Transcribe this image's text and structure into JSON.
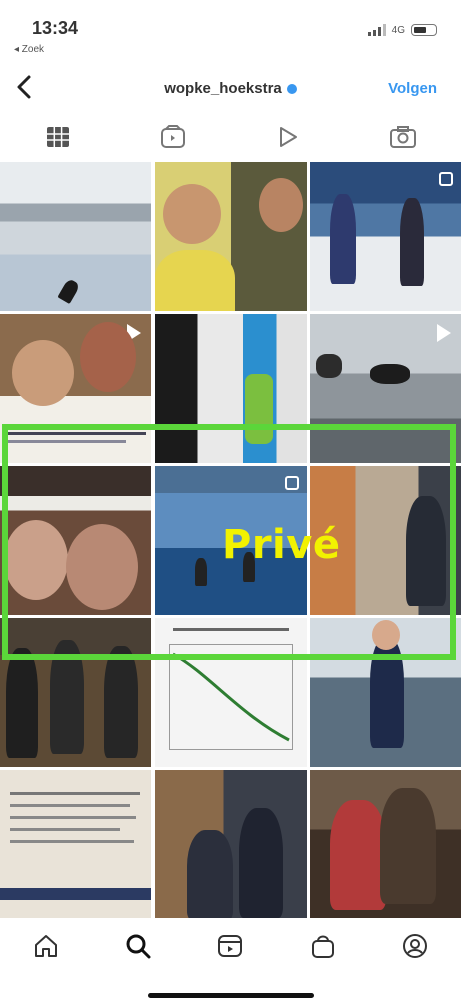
{
  "status_bar": {
    "time": "13:34",
    "back_app": "◂ Zoek",
    "network": "4G"
  },
  "profile_header": {
    "back_icon": "chevron-left-icon",
    "username": "wopke_hoekstra",
    "follow_label": "Volgen"
  },
  "profile_tabs": [
    {
      "name": "grid-icon",
      "selected": true
    },
    {
      "name": "guides-icon",
      "selected": false
    },
    {
      "name": "reels-icon",
      "selected": false
    },
    {
      "name": "tagged-icon",
      "selected": false
    }
  ],
  "overlay": {
    "label": "Privé",
    "highlight_color": "#5bd63a",
    "label_color": "#f2f200"
  },
  "bottom_nav": [
    {
      "name": "home-icon"
    },
    {
      "name": "search-icon"
    },
    {
      "name": "reels-icon"
    },
    {
      "name": "shop-icon"
    },
    {
      "name": "profile-icon"
    }
  ],
  "colors": {
    "accent": "#3897f0"
  }
}
